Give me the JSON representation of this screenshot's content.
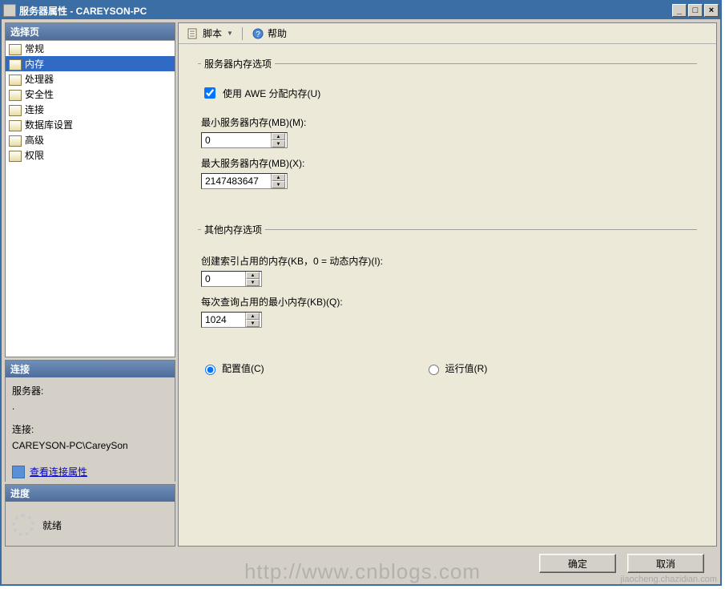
{
  "window": {
    "title": "服务器属性 - CAREYSON-PC"
  },
  "titlebar_buttons": {
    "min": "_",
    "max": "□",
    "close": "×"
  },
  "left": {
    "select_header": "选择页",
    "pages": [
      {
        "label": "常规",
        "selected": false
      },
      {
        "label": "内存",
        "selected": true
      },
      {
        "label": "处理器",
        "selected": false
      },
      {
        "label": "安全性",
        "selected": false
      },
      {
        "label": "连接",
        "selected": false
      },
      {
        "label": "数据库设置",
        "selected": false
      },
      {
        "label": "高级",
        "selected": false
      },
      {
        "label": "权限",
        "selected": false
      }
    ],
    "connection_header": "连接",
    "conn_server_label": "服务器:",
    "conn_server_value": ".",
    "conn_label": "连接:",
    "conn_value": "CAREYSON-PC\\CareySon",
    "view_conn_props": "查看连接属性",
    "progress_header": "进度",
    "progress_status": "就绪"
  },
  "toolbar": {
    "script": "脚本",
    "help": "帮助"
  },
  "memory": {
    "server_mem_legend": "服务器内存选项",
    "use_awe_label": "使用 AWE 分配内存(U)",
    "use_awe_checked": true,
    "min_label": "最小服务器内存(MB)(M):",
    "min_value": "0",
    "max_label": "最大服务器内存(MB)(X):",
    "max_value": "2147483647",
    "other_legend": "其他内存选项",
    "index_label": "创建索引占用的内存(KB，0 = 动态内存)(I):",
    "index_value": "0",
    "query_label": "每次查询占用的最小内存(KB)(Q):",
    "query_value": "1024",
    "radio_config": "配置值(C)",
    "radio_run": "运行值(R)"
  },
  "buttons": {
    "ok": "确定",
    "cancel": "取消"
  },
  "watermark": "http://www.cnblogs.com",
  "watermark2": "jiaocheng.chazidian.com"
}
